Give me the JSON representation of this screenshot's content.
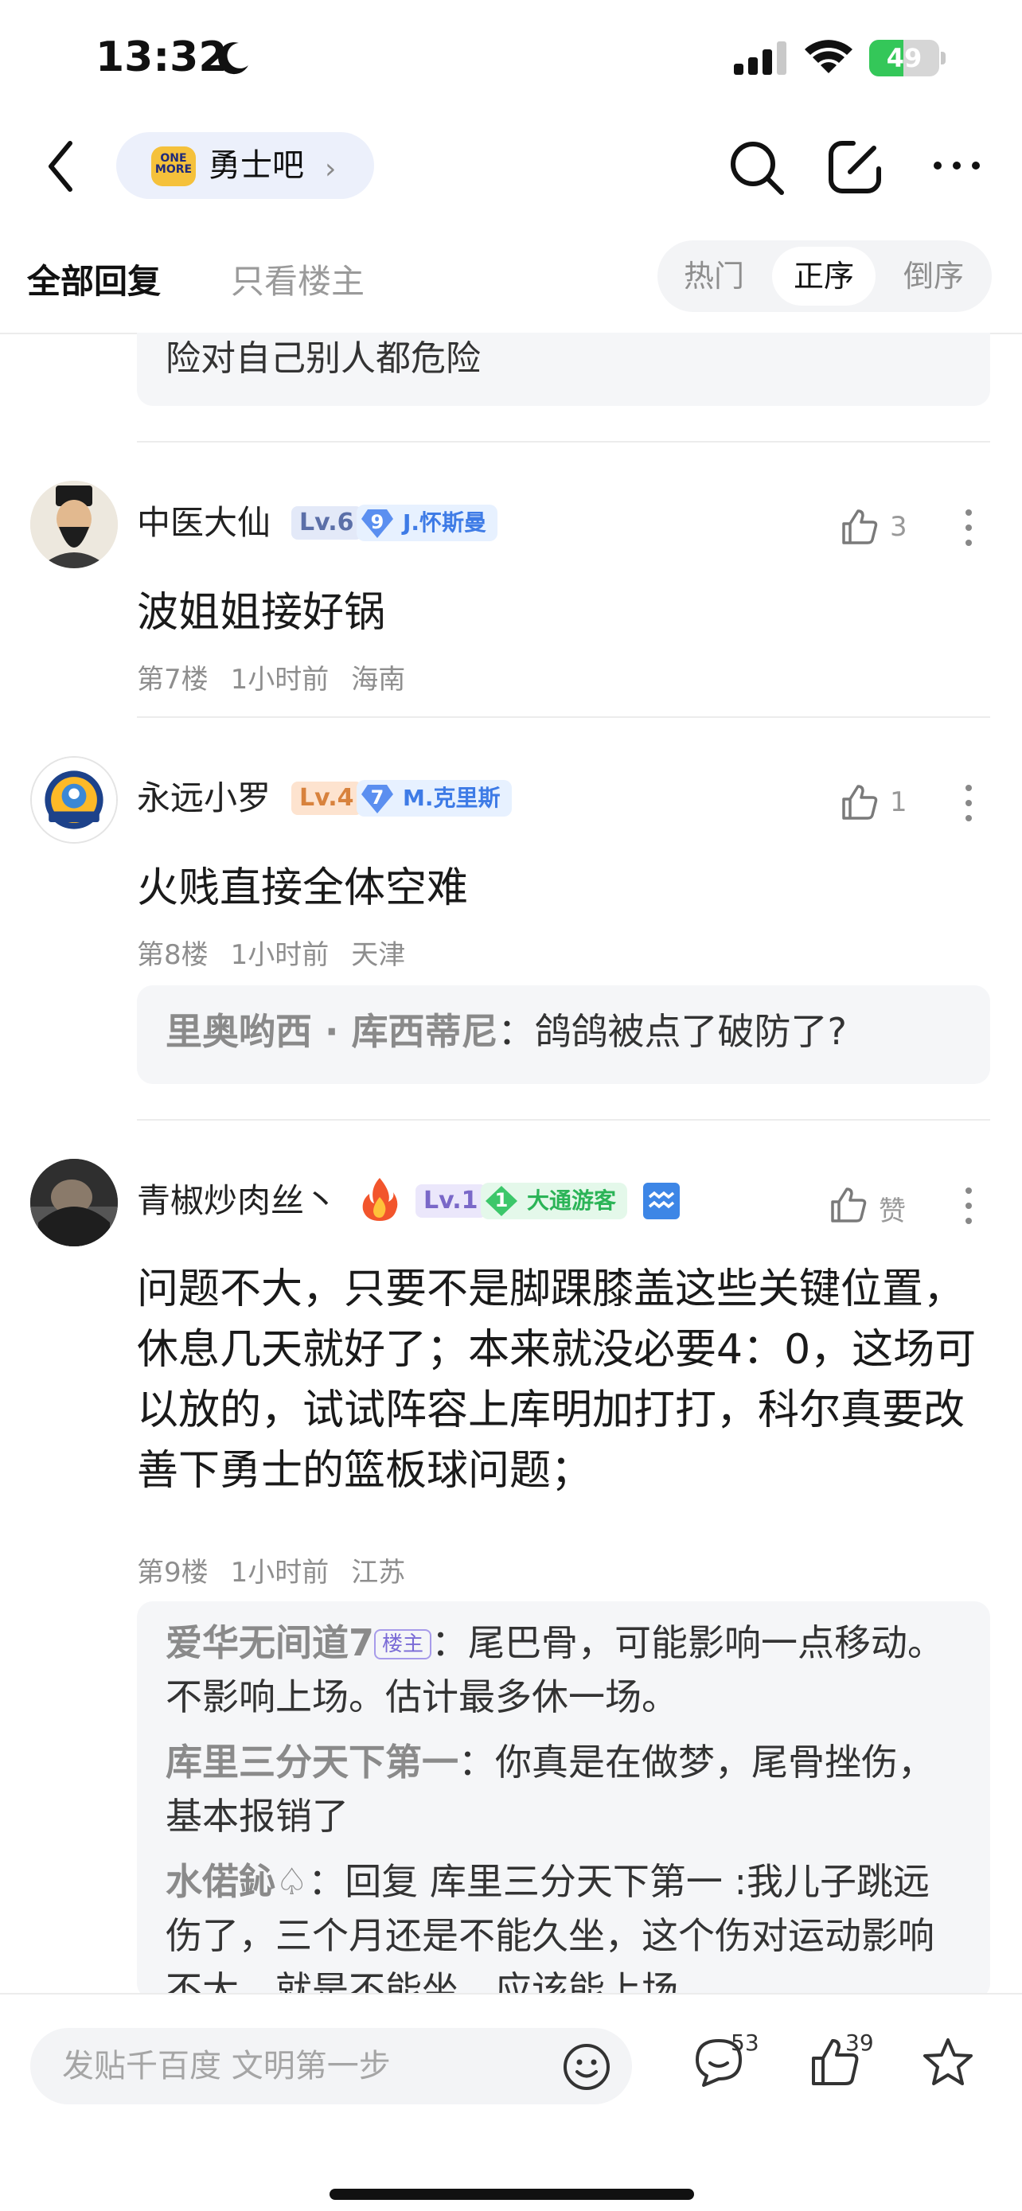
{
  "status_bar": {
    "time": "13:32",
    "battery": "49",
    "battery_level": 0.49
  },
  "nav": {
    "forum_name": "勇士吧",
    "forum_logo_text": "ONE MORE"
  },
  "tabs": {
    "all": "全部回复",
    "op_only": "只看楼主"
  },
  "sort": {
    "hot": "热门",
    "asc": "正序",
    "desc": "倒序"
  },
  "partial_reply": {
    "text": "险对自己别人都危险"
  },
  "posts": [
    {
      "username": "中医大仙",
      "level": "Lv.6",
      "team_level": "9",
      "team": "J.怀斯曼",
      "likes": "3",
      "content": "波姐姐接好锅",
      "floor": "第7楼",
      "time": "1小时前",
      "location": "海南"
    },
    {
      "username": "永远小罗",
      "level": "Lv.4",
      "team_level": "7",
      "team": "M.克里斯",
      "likes": "1",
      "content": "火贱直接全体空难",
      "floor": "第8楼",
      "time": "1小时前",
      "location": "天津",
      "replies": [
        {
          "author": "里奥哟西 · 库西蒂尼",
          "text": "鸽鸽被点了破防了?"
        }
      ]
    },
    {
      "username": "青椒炒肉丝丶",
      "level": "Lv.1",
      "team_level": "1",
      "team": "大通游客",
      "likes": "赞",
      "content": "问题不大，只要不是脚踝膝盖这些关键位置，休息几天就好了；本来就没必要4：0，这场可以放的，试试阵容上库明加打打，科尔真要改善下勇士的篮板球问题；",
      "floor": "第9楼",
      "time": "1小时前",
      "location": "江苏",
      "replies": [
        {
          "author": "爱华无间道7",
          "op_tag": "楼主",
          "text": "尾巴骨，可能影响一点移动。不影响上场。估计最多休一场。"
        },
        {
          "author": "库里三分天下第一",
          "text": "你真是在做梦，尾骨挫伤，基本报销了"
        },
        {
          "author": "水偌鈊♤",
          "text": "回复 库里三分天下第一 :我儿子跳远伤了，三个月还是不能久坐，这个伤对运动影响不大，就是不能坐，应该能上场"
        }
      ]
    }
  ],
  "bottom_bar": {
    "placeholder": "发贴千百度 文明第一步",
    "comment_count": "53",
    "like_count": "39"
  },
  "colors": {
    "accent_green": "#34c759",
    "level_blue": "#e3e9f8",
    "level_orange": "#fde3cf",
    "level_purple": "#ebe7fb",
    "team_badge_bg": "#e7f1ff"
  }
}
